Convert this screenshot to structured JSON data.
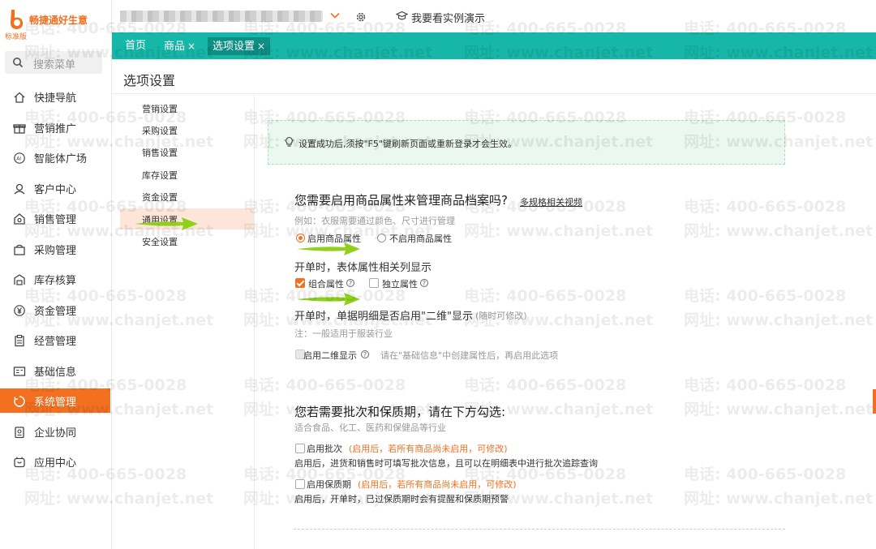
{
  "app": {
    "name": "畅捷通好生意",
    "edition": "标准版",
    "demo_link": "我要看实例演示"
  },
  "search": {
    "placeholder": "搜索菜单"
  },
  "sidebar": {
    "items": [
      {
        "label": "快捷导航",
        "icon": "home-icon"
      },
      {
        "label": "营销推广",
        "icon": "gift-icon"
      },
      {
        "label": "智能体广场",
        "icon": "ai-icon"
      },
      {
        "label": "客户中心",
        "icon": "customer-icon"
      },
      {
        "label": "销售管理",
        "icon": "sales-icon"
      },
      {
        "label": "采购管理",
        "icon": "bag-icon"
      },
      {
        "label": "库存核算",
        "icon": "warehouse-icon"
      },
      {
        "label": "资金管理",
        "icon": "yen-icon"
      },
      {
        "label": "经营管理",
        "icon": "clipboard-icon"
      },
      {
        "label": "基础信息",
        "icon": "card-icon"
      },
      {
        "label": "系统管理",
        "icon": "system-icon",
        "active": true
      },
      {
        "label": "企业协同",
        "icon": "collab-icon"
      },
      {
        "label": "应用中心",
        "icon": "app-center-icon"
      }
    ]
  },
  "tabs": [
    {
      "label": "首页",
      "closable": false
    },
    {
      "label": "商品",
      "closable": true
    },
    {
      "label": "选项设置",
      "closable": true,
      "active": true
    }
  ],
  "tab_close_glyph": "×",
  "page": {
    "title": "选项设置"
  },
  "subnav": {
    "items": [
      {
        "label": "营销设置"
      },
      {
        "label": "采购设置"
      },
      {
        "label": "销售设置"
      },
      {
        "label": "库存设置"
      },
      {
        "label": "资金设置"
      },
      {
        "label": "通用设置",
        "active": true
      },
      {
        "label": "安全设置"
      }
    ]
  },
  "notice": {
    "text": "设置成功后,须按\"F5\"键刷新页面或重新登录才会生效。"
  },
  "attributes": {
    "question": "您需要启用商品属性来管理商品档案吗?",
    "video_link": "多规格相关视频",
    "example": "例如：衣服需要通过颜色、尺寸进行管理",
    "options": [
      {
        "label": "启用商品属性",
        "selected": true
      },
      {
        "label": "不启用商品属性",
        "selected": false
      }
    ],
    "display_heading": "开单时，表体属性相关列显示",
    "display_options": [
      {
        "label": "组合属性",
        "checked": true
      },
      {
        "label": "独立属性",
        "checked": false
      }
    ],
    "two_d_heading": "开单时，单据明细是否启用\"二维\"显示",
    "two_d_note": "(随时可修改)",
    "two_d_remark": "注：一般适用于服装行业",
    "two_d_option": "启用二维显示",
    "two_d_hint": "请在\"基础信息\"中创建属性后，再启用此选项",
    "help_glyph": "?"
  },
  "batch": {
    "heading": "您若需要批次和保质期，请在下方勾选:",
    "subheading": "适合食品、化工、医药和保健品等行业",
    "batch_option": "启用批次",
    "batch_warning": "(启用后，若所有商品尚未启用，可修改)",
    "batch_desc": "启用后，进货和销售时可填写批次信息，且可以在明细表中进行批次追踪查询",
    "shelf_option": "启用保质期",
    "shelf_warning": "(启用后，若所有商品尚未启用，可修改)",
    "shelf_desc": "启用后，开单时，已过保质期时会有提醒和保质期预警"
  },
  "watermark": {
    "phone": "电话: 400-665-0028",
    "site": "网址: www.chanjet.net"
  },
  "colors": {
    "brand_orange": "#f37021",
    "tab_teal": "#16b7a8",
    "tab_active": "#0d8f83",
    "arrow_green": "#8fd01a"
  }
}
